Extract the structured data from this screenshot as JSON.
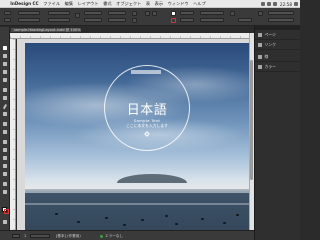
{
  "menubar": {
    "app_name": "InDesign CC",
    "items": [
      "ファイル",
      "編集",
      "レイアウト",
      "書式",
      "オブジェクト",
      "表",
      "表示",
      "ウィンドウ",
      "ヘルプ"
    ],
    "clock": "22:58"
  },
  "document_tab": {
    "label": "sample-HeadingLayout.indd @ 100%"
  },
  "page": {
    "title_jp": "日本語",
    "subtitle_en": "Sample Text",
    "subtitle_jp": "ここに本文を入力します"
  },
  "panels": {
    "items": [
      {
        "icon": "pages-icon",
        "label": "ページ"
      },
      {
        "icon": "links-icon",
        "label": "リンク"
      },
      {
        "icon": "stroke-icon",
        "label": "線"
      },
      {
        "icon": "swatches-icon",
        "label": "カラー"
      }
    ]
  },
  "status": {
    "page_number": "1",
    "preflight_label": "[基本] (作業用)",
    "errors": "エラーなし"
  },
  "colors": {
    "ui_dark": "#3a3a3a",
    "panel_bg": "#2f2f2f",
    "status_ok": "#3c9d46",
    "stroke_swatch": "#dd3333"
  }
}
